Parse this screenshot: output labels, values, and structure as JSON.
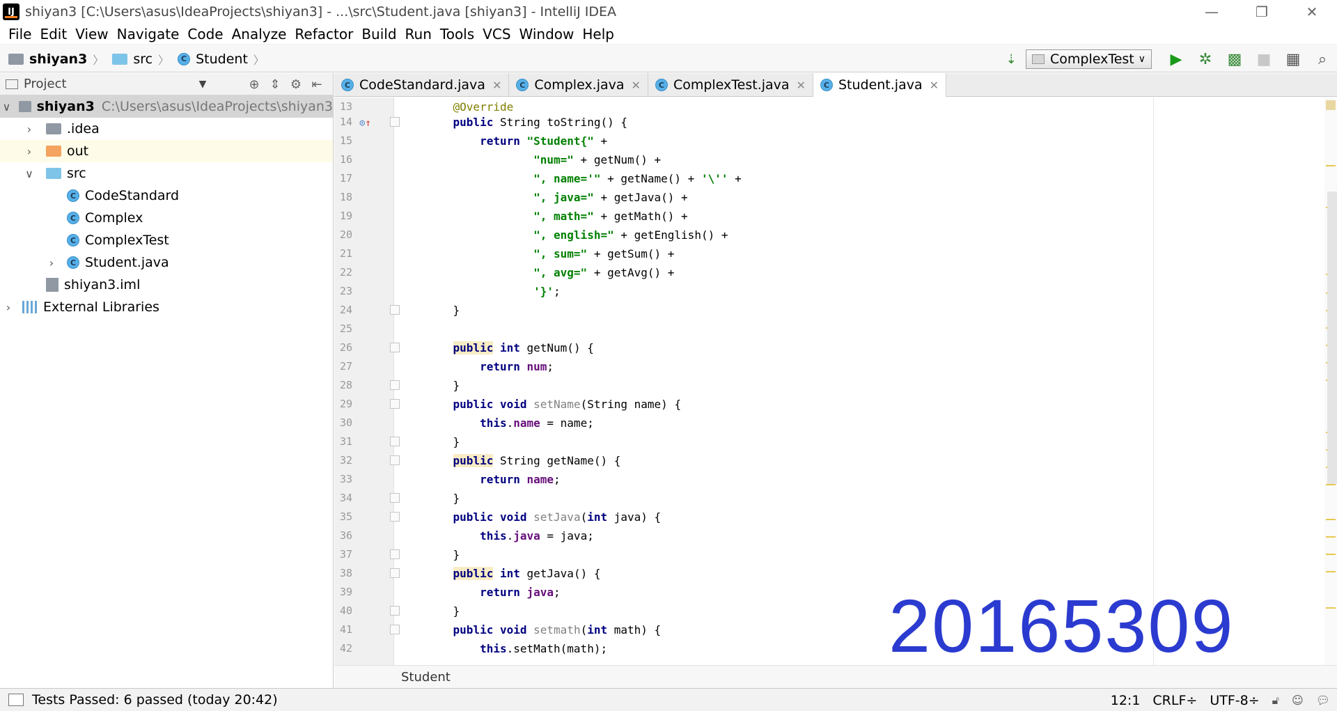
{
  "window": {
    "title": "shiyan3 [C:\\Users\\asus\\IdeaProjects\\shiyan3] - ...\\src\\Student.java [shiyan3] - IntelliJ IDEA",
    "app_icon": "IJ",
    "controls": {
      "minimize": "—",
      "restore": "❐",
      "close": "✕"
    }
  },
  "menu": [
    "File",
    "Edit",
    "View",
    "Navigate",
    "Code",
    "Analyze",
    "Refactor",
    "Build",
    "Run",
    "Tools",
    "VCS",
    "Window",
    "Help"
  ],
  "navbar": {
    "crumbs": [
      "shiyan3",
      "src",
      "Student"
    ],
    "run_config": "ComplexTest"
  },
  "project_panel": {
    "header": "Project",
    "tree": [
      {
        "label": "shiyan3",
        "hint": "C:\\Users\\asus\\IdeaProjects\\shiyan3"
      },
      {
        "label": ".idea"
      },
      {
        "label": "out"
      },
      {
        "label": "src"
      },
      {
        "label": "CodeStandard"
      },
      {
        "label": "Complex"
      },
      {
        "label": "ComplexTest"
      },
      {
        "label": "Student.java"
      },
      {
        "label": "shiyan3.iml"
      },
      {
        "label": "External Libraries"
      }
    ]
  },
  "tabs": [
    "CodeStandard.java",
    "Complex.java",
    "ComplexTest.java",
    "Student.java"
  ],
  "editor": {
    "line_numbers": [
      "13",
      "14",
      "15",
      "16",
      "17",
      "18",
      "19",
      "20",
      "21",
      "22",
      "23",
      "24",
      "25",
      "26",
      "27",
      "28",
      "29",
      "30",
      "31",
      "32",
      "33",
      "34",
      "35",
      "36",
      "37",
      "38",
      "39",
      "40",
      "41",
      "42"
    ],
    "watermark": "20165309",
    "breadcrumb": "Student"
  },
  "status": {
    "message": "Tests Passed: 6 passed (today 20:42)",
    "position": "12:1",
    "line_sep": "CRLF÷",
    "encoding": "UTF-8÷"
  },
  "colors": {
    "keyword": "#000080",
    "string": "#008000",
    "annotation": "#808000",
    "field": "#660e7a",
    "watermark": "#2b3bd0"
  }
}
